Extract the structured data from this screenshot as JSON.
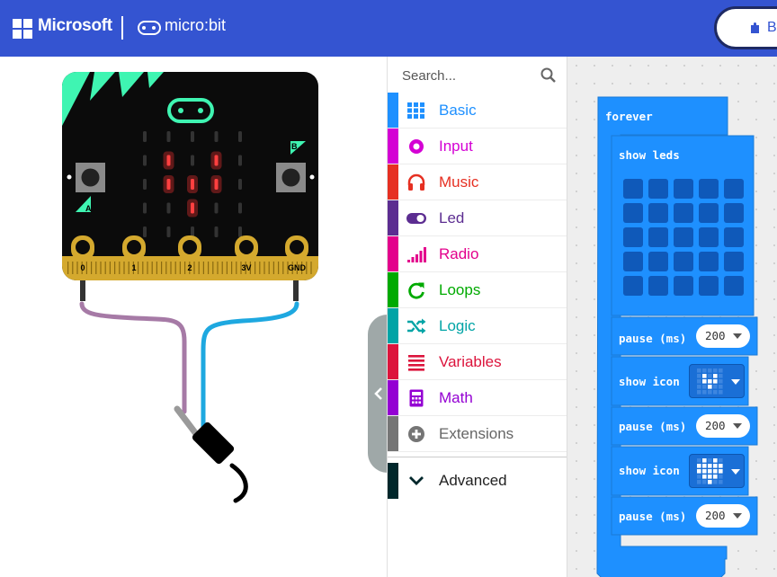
{
  "header": {
    "brand": "Microsoft",
    "product": "micro:bit",
    "blocks_label": "B"
  },
  "simulator": {
    "pins": [
      "0",
      "1",
      "2",
      "3V",
      "GND"
    ],
    "button_a": "A",
    "button_b": "B",
    "led_on": [
      [
        1,
        1
      ],
      [
        3,
        1
      ],
      [
        1,
        2
      ],
      [
        2,
        2
      ],
      [
        3,
        2
      ],
      [
        2,
        3
      ]
    ]
  },
  "toolbox": {
    "search_placeholder": "Search...",
    "categories": [
      {
        "label": "Basic",
        "color": "#1e90ff",
        "icon": "grid-icon"
      },
      {
        "label": "Input",
        "color": "#d400d4",
        "icon": "circle-dot-icon"
      },
      {
        "label": "Music",
        "color": "#e63022",
        "icon": "headphones-icon"
      },
      {
        "label": "Led",
        "color": "#5c2d91",
        "icon": "toggle-icon"
      },
      {
        "label": "Radio",
        "color": "#e3008c",
        "icon": "signal-bars-icon"
      },
      {
        "label": "Loops",
        "color": "#00aa00",
        "icon": "refresh-icon"
      },
      {
        "label": "Logic",
        "color": "#00a4a6",
        "icon": "shuffle-icon"
      },
      {
        "label": "Variables",
        "color": "#dc143c",
        "icon": "list-icon"
      },
      {
        "label": "Math",
        "color": "#9400d3",
        "icon": "calculator-icon"
      },
      {
        "label": "Extensions",
        "color": "#757575",
        "icon": "plus-circle-icon"
      }
    ],
    "advanced": {
      "label": "Advanced",
      "color": "#00272b",
      "icon": "chevron-down-icon"
    }
  },
  "workspace": {
    "forever_label": "forever",
    "show_leds_label": "show leds",
    "pause_label": "pause (ms)",
    "show_icon_label": "show icon",
    "pause_values": [
      "200",
      "200",
      "200"
    ],
    "block_color": "#1e90ff"
  }
}
